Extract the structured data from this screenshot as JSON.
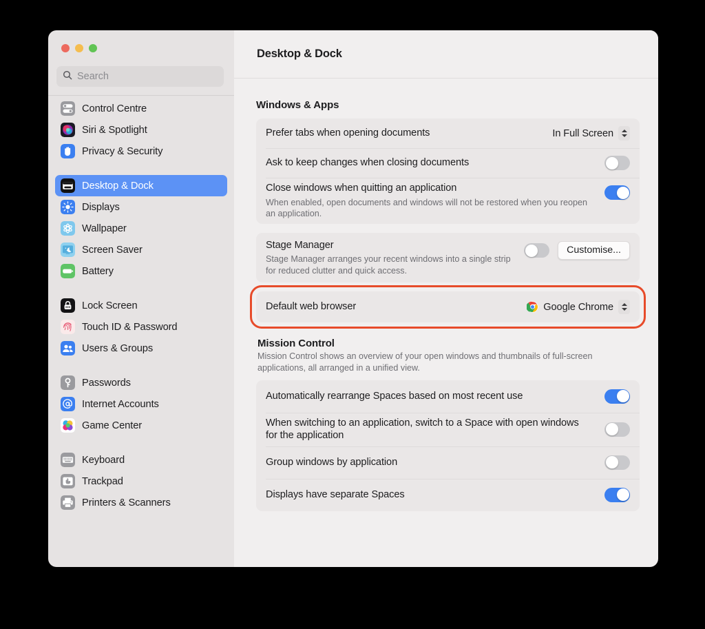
{
  "window": {
    "traffic_lights": [
      {
        "name": "close",
        "color": "#ED6A5E"
      },
      {
        "name": "minimize",
        "color": "#F5BD4F"
      },
      {
        "name": "zoom",
        "color": "#61C454"
      }
    ]
  },
  "search": {
    "value": "",
    "placeholder": "Search"
  },
  "sidebar": {
    "groups": [
      {
        "items": [
          {
            "label": "Control Centre",
            "icon": "control-centre-icon",
            "selected": false
          },
          {
            "label": "Siri & Spotlight",
            "icon": "siri-icon",
            "selected": false
          },
          {
            "label": "Privacy & Security",
            "icon": "privacy-hand-icon",
            "selected": false
          }
        ]
      },
      {
        "items": [
          {
            "label": "Desktop & Dock",
            "icon": "desktop-dock-icon",
            "selected": true
          },
          {
            "label": "Displays",
            "icon": "displays-icon",
            "selected": false
          },
          {
            "label": "Wallpaper",
            "icon": "wallpaper-icon",
            "selected": false
          },
          {
            "label": "Screen Saver",
            "icon": "screen-saver-icon",
            "selected": false
          },
          {
            "label": "Battery",
            "icon": "battery-icon",
            "selected": false
          }
        ]
      },
      {
        "items": [
          {
            "label": "Lock Screen",
            "icon": "lock-screen-icon",
            "selected": false
          },
          {
            "label": "Touch ID & Password",
            "icon": "touch-id-icon",
            "selected": false
          },
          {
            "label": "Users & Groups",
            "icon": "users-groups-icon",
            "selected": false
          }
        ]
      },
      {
        "items": [
          {
            "label": "Passwords",
            "icon": "passwords-key-icon",
            "selected": false
          },
          {
            "label": "Internet Accounts",
            "icon": "internet-accounts-icon",
            "selected": false
          },
          {
            "label": "Game Center",
            "icon": "game-center-icon",
            "selected": false
          }
        ]
      },
      {
        "items": [
          {
            "label": "Keyboard",
            "icon": "keyboard-icon",
            "selected": false
          },
          {
            "label": "Trackpad",
            "icon": "trackpad-icon",
            "selected": false
          },
          {
            "label": "Printers & Scanners",
            "icon": "printer-icon",
            "selected": false
          }
        ]
      }
    ]
  },
  "header": {
    "title": "Desktop & Dock"
  },
  "windows_apps": {
    "section_title": "Windows & Apps",
    "prefer_tabs": {
      "label": "Prefer tabs when opening documents",
      "value": "In Full Screen"
    },
    "ask_keep_changes": {
      "label": "Ask to keep changes when closing documents",
      "state": "off"
    },
    "close_windows": {
      "label": "Close windows when quitting an application",
      "desc": "When enabled, open documents and windows will not be restored when you reopen an application.",
      "state": "on"
    },
    "stage_manager": {
      "label": "Stage Manager",
      "desc": "Stage Manager arranges your recent windows into a single strip for reduced clutter and quick access.",
      "state": "off",
      "button": "Customise..."
    },
    "default_browser": {
      "label": "Default web browser",
      "value": "Google Chrome",
      "icon": "chrome-icon",
      "highlighted": true,
      "highlight_color": "#E74B2A"
    }
  },
  "mission_control": {
    "section_title": "Mission Control",
    "desc": "Mission Control shows an overview of your open windows and thumbnails of full-screen applications, all arranged in a unified view.",
    "rows": [
      {
        "label": "Automatically rearrange Spaces based on most recent use",
        "state": "on"
      },
      {
        "label": "When switching to an application, switch to a Space with open windows for the application",
        "state": "off"
      },
      {
        "label": "Group windows by application",
        "state": "off"
      },
      {
        "label": "Displays have separate Spaces",
        "state": "on"
      }
    ]
  }
}
